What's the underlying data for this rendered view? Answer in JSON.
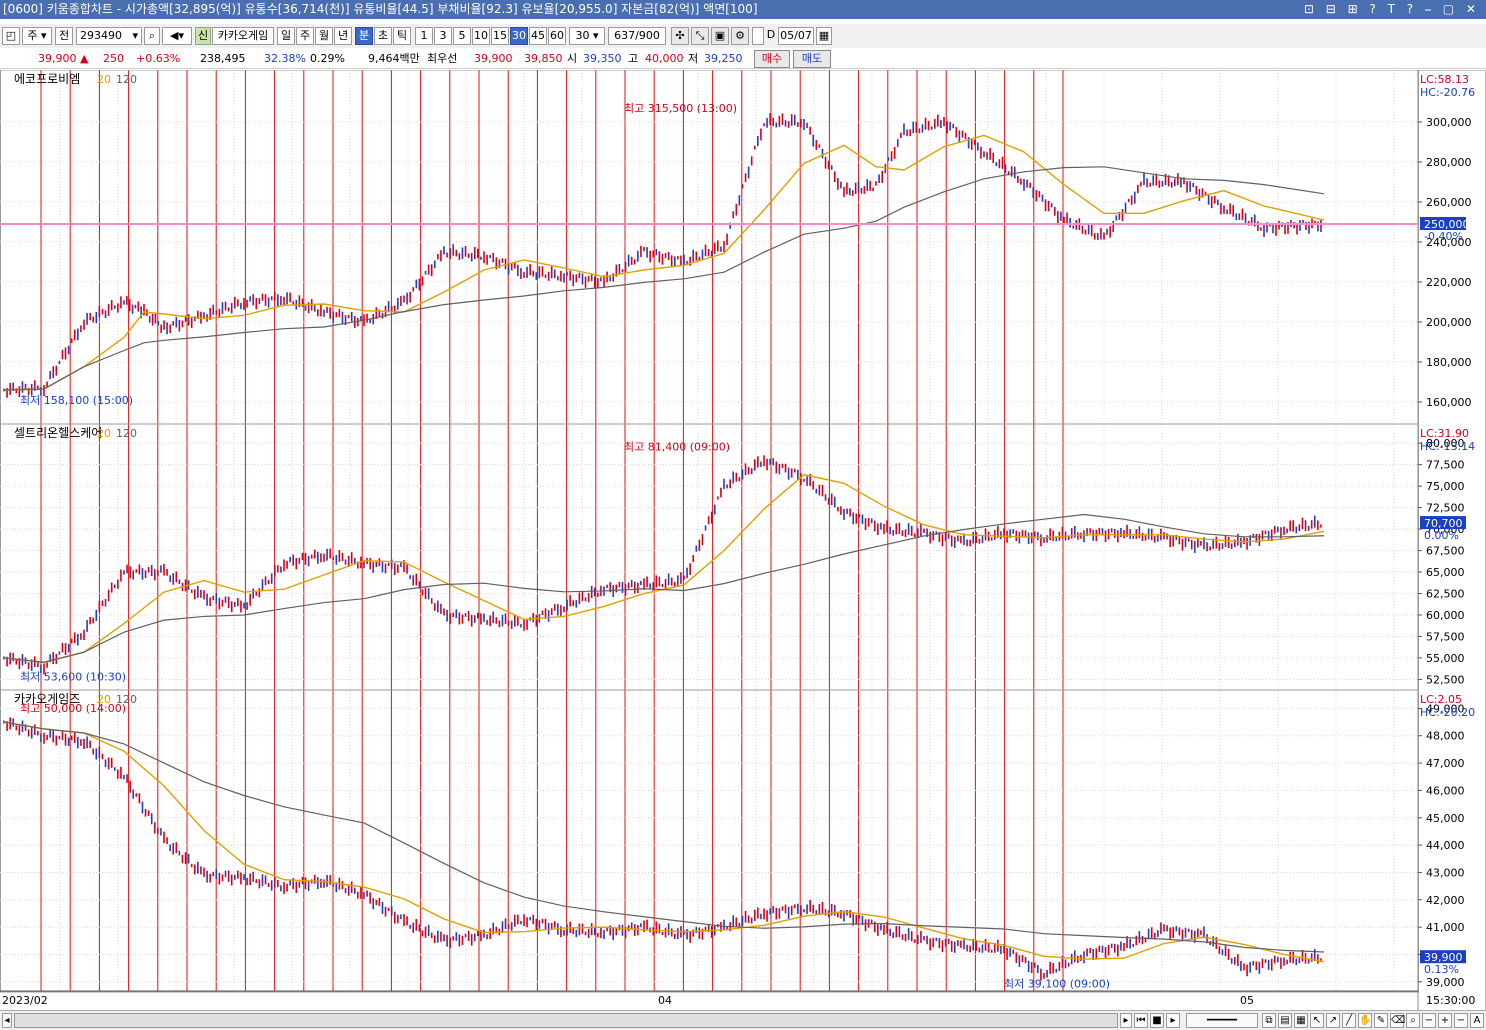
{
  "window": {
    "title": "[0600] 키움종합차트 - 시가총액[32,895(억)] 유통수[36,714(천)] 유통비율[44.5] 부채비율[92.3] 유보율[20,955.0] 자본금[82(억)] 액면[100]",
    "controls": "⊡ ⊟ ⊞ ? T ? ⎯ ▢ ✕"
  },
  "toolbar": {
    "period_unit": "주",
    "prev_label": "전",
    "code": "293490",
    "badge": "신",
    "stock_name": "카카오게임",
    "tf": [
      "일",
      "주",
      "월",
      "년",
      "분",
      "초",
      "틱"
    ],
    "tf_selected": "분",
    "minutes": [
      "1",
      "3",
      "5",
      "10",
      "15",
      "30",
      "45",
      "60"
    ],
    "minute_selected": "30",
    "count_value": "30",
    "range": "637/900",
    "d_label": "D",
    "date": "05/07"
  },
  "quote": {
    "price": "39,900 ▲",
    "change": "250",
    "pct": "+0.63%",
    "volume": "238,495",
    "ratio": "32.38%",
    "turnover": "0.29%",
    "amount": "9,464백만",
    "prio_label": "최우선",
    "ask": "39,900",
    "bid": "39,850",
    "open_label": "시",
    "open": "39,350",
    "high_label": "고",
    "high": "40,000",
    "low_label": "저",
    "low": "39,250",
    "buy": "매수",
    "sell": "매도"
  },
  "panels": [
    {
      "name": "에코프로비엠",
      "ma1": "20",
      "ma2": "120",
      "lc": "LC:58.13",
      "hc": "HC:-20.76",
      "price_tag": "250,000",
      "pct_tag": "-0.40%",
      "hi_label": "최고 315,500 (13:00)",
      "lo_label": "최저 158,100 (15:00)",
      "ticks": [
        "300,000",
        "280,000",
        "260,000",
        "240,000",
        "220,000",
        "200,000",
        "180,000",
        "160,000"
      ]
    },
    {
      "name": "셀트리온헬스케어",
      "ma1": "20",
      "ma2": "120",
      "lc": "LC:31.90",
      "hc": "HC:-13.14",
      "price_tag": "70,700",
      "pct_tag": "0.00%",
      "hi_label": "최고 81,400 (09:00)",
      "lo_label": "최저 53,600 (10:30)",
      "ticks": [
        "80,000",
        "77,500",
        "75,000",
        "72,500",
        "70,000",
        "67,500",
        "65,000",
        "62,500",
        "60,000",
        "57,500",
        "55,000",
        "52,500"
      ]
    },
    {
      "name": "카카오게임즈",
      "ma1": "20",
      "ma2": "120",
      "lc": "LC:2.05",
      "hc": "HC:-20.20",
      "price_tag": "39,900",
      "pct_tag": "0.13%",
      "hi_label": "최고 50,000 (14:00)",
      "lo_label": "최저 39,100 (09:00)",
      "ticks": [
        "49,000",
        "48,000",
        "47,000",
        "46,000",
        "45,000",
        "44,000",
        "43,000",
        "42,000",
        "41,000",
        "40,000",
        "39,000"
      ]
    }
  ],
  "xaxis": {
    "labels": [
      "2023/02",
      "04",
      "05"
    ],
    "time": "15:30:00"
  },
  "chart_data": [
    {
      "type": "line",
      "name": "에코프로비엠",
      "ylim": [
        150000,
        325000
      ],
      "x": [
        0,
        10,
        20,
        30,
        35,
        40,
        50,
        60,
        70,
        80,
        90,
        100,
        110,
        120,
        130,
        140,
        150,
        160,
        170,
        180,
        190,
        200,
        210,
        218,
        225,
        235,
        245,
        255,
        265,
        275,
        285,
        295,
        305,
        315,
        330
      ],
      "values": [
        166000,
        167000,
        200000,
        210000,
        205000,
        197000,
        203000,
        210000,
        212000,
        205000,
        200000,
        210000,
        235000,
        233000,
        225000,
        223000,
        220000,
        235000,
        230000,
        238000,
        300000,
        300000,
        265000,
        268000,
        295000,
        300000,
        285000,
        270000,
        251000,
        242000,
        270000,
        270000,
        257000,
        247000,
        249000
      ],
      "colors": {
        "ma20": "#e0a000",
        "ma120": "#606060",
        "price": "#d4001a",
        "down": "#1a3fc8",
        "hline": "#ff88cc"
      }
    },
    {
      "type": "line",
      "name": "셀트리온헬스케어",
      "ylim": [
        51500,
        82000
      ],
      "x": [
        0,
        10,
        20,
        30,
        40,
        50,
        60,
        70,
        80,
        90,
        100,
        110,
        120,
        130,
        140,
        150,
        160,
        170,
        180,
        190,
        200,
        210,
        220,
        230,
        240,
        250,
        260,
        270,
        280,
        290,
        300,
        310,
        320,
        330
      ],
      "values": [
        55000,
        54000,
        58000,
        65000,
        65000,
        62000,
        61000,
        66000,
        67000,
        66000,
        65500,
        60000,
        59500,
        59000,
        61000,
        63000,
        63500,
        64000,
        75000,
        78000,
        76000,
        72000,
        70000,
        69500,
        68500,
        69500,
        69000,
        69500,
        69500,
        69000,
        68000,
        68500,
        70000,
        70700
      ]
    },
    {
      "type": "line",
      "name": "카카오게임즈",
      "ylim": [
        38700,
        49600
      ],
      "x": [
        0,
        10,
        20,
        30,
        40,
        50,
        60,
        70,
        80,
        90,
        100,
        110,
        120,
        130,
        140,
        150,
        160,
        170,
        180,
        190,
        200,
        210,
        220,
        230,
        240,
        250,
        260,
        270,
        280,
        290,
        300,
        310,
        320,
        330
      ],
      "values": [
        48500,
        48000,
        47800,
        46500,
        44200,
        42900,
        42800,
        42500,
        42700,
        42200,
        41200,
        40500,
        40700,
        41300,
        40900,
        40800,
        41000,
        40700,
        41000,
        41500,
        41700,
        41500,
        40900,
        40500,
        40300,
        40200,
        39300,
        40000,
        40300,
        40900,
        40700,
        39500,
        39800,
        39900
      ]
    }
  ]
}
